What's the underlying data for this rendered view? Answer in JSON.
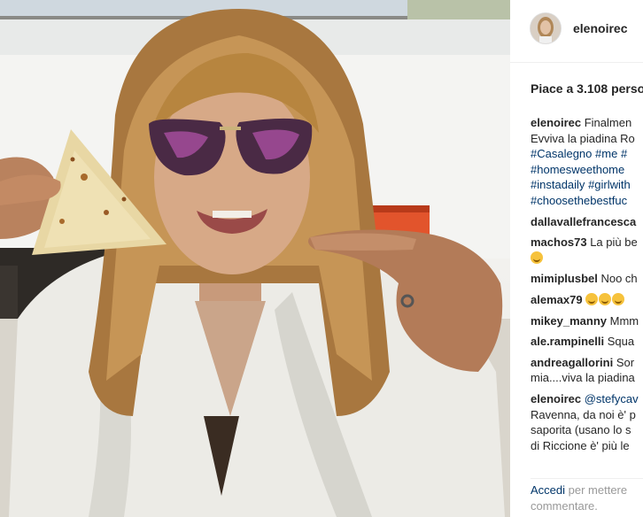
{
  "post": {
    "username": "elenoirec",
    "likes_text": "Piace a 3.108 perso"
  },
  "comments": [
    {
      "lines": [
        {
          "user": "elenoirec",
          "text": " Finalmen"
        },
        {
          "text": "Evviva la piadina Ro"
        },
        {
          "tags": [
            "#Casalegno",
            "#me",
            "#"
          ]
        },
        {
          "tags": [
            "#homesweethome"
          ]
        },
        {
          "tags": [
            "#instadaily",
            "#girlwith"
          ]
        },
        {
          "tags": [
            "#choosethebestfuc"
          ]
        }
      ]
    },
    {
      "lines": [
        {
          "user": "dallavallefrancesca",
          "text": ""
        }
      ]
    },
    {
      "lines": [
        {
          "user": "machos73",
          "text": " La più be"
        },
        {
          "emoji": 1
        }
      ]
    },
    {
      "lines": [
        {
          "user": "mimiplusbel",
          "text": " Noo ch"
        }
      ]
    },
    {
      "lines": [
        {
          "user": "alemax79",
          "text": " ",
          "emoji": 3
        }
      ]
    },
    {
      "lines": [
        {
          "user": "mikey_manny",
          "text": " Mmm"
        }
      ]
    },
    {
      "lines": [
        {
          "user": "ale.rampinelli",
          "text": " Squa"
        }
      ]
    },
    {
      "lines": [
        {
          "user": "andreagallorini",
          "text": " Sor"
        },
        {
          "text": "mia....viva la piadina"
        }
      ]
    },
    {
      "lines": [
        {
          "user": "elenoirec",
          "text": " ",
          "mention": "@stefycav"
        },
        {
          "text": "Ravenna, da noi è' p"
        },
        {
          "text": "saporita (usano lo s"
        },
        {
          "text": "di Riccione è' più le"
        }
      ]
    }
  ],
  "footer": {
    "login_link": "Accedi",
    "login_text": " per mettere",
    "login_text2": "commentare."
  }
}
